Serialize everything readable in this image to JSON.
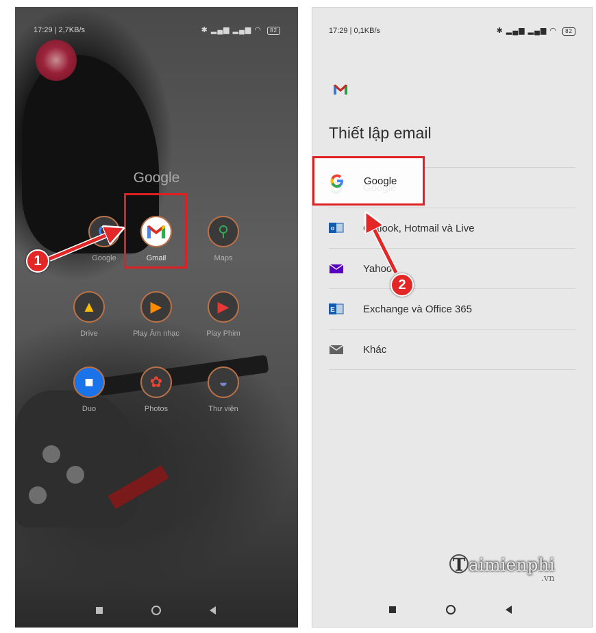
{
  "left_screen": {
    "status_time": "17:29 | 2,7KB/s",
    "status_icons": "alarm, notification, bluetooth, signal, signal, wifi",
    "battery": "82",
    "folder_title": "Google",
    "apps": [
      {
        "label": "Google",
        "icon": "google-icon"
      },
      {
        "label": "Gmail",
        "icon": "gmail-icon"
      },
      {
        "label": "Maps",
        "icon": "maps-icon"
      },
      {
        "label": "Drive",
        "icon": "drive-icon"
      },
      {
        "label": "Play Âm nhạc",
        "icon": "play-music-icon"
      },
      {
        "label": "Play Phim",
        "icon": "play-movies-icon"
      },
      {
        "label": "Duo",
        "icon": "duo-icon"
      },
      {
        "label": "Photos",
        "icon": "photos-icon"
      },
      {
        "label": "Thư viện",
        "icon": "gallery-icon"
      }
    ],
    "step_badge": "1"
  },
  "right_screen": {
    "status_time": "17:29 | 0,1KB/s",
    "battery": "82",
    "title": "Thiết lập email",
    "options": [
      {
        "label": "Google",
        "icon": "google-g-icon"
      },
      {
        "label": "Outlook, Hotmail và Live",
        "icon": "outlook-icon"
      },
      {
        "label": "Yahoo",
        "icon": "yahoo-mail-icon"
      },
      {
        "label": "Exchange và Office 365",
        "icon": "exchange-icon"
      },
      {
        "label": "Khác",
        "icon": "mail-icon"
      }
    ],
    "step_badge": "2"
  },
  "watermark": {
    "main": "aimienphi",
    "tld": ".vn"
  },
  "colors": {
    "highlight": "#e02020",
    "badge": "#e32626",
    "gmail_red": "#d93025"
  }
}
